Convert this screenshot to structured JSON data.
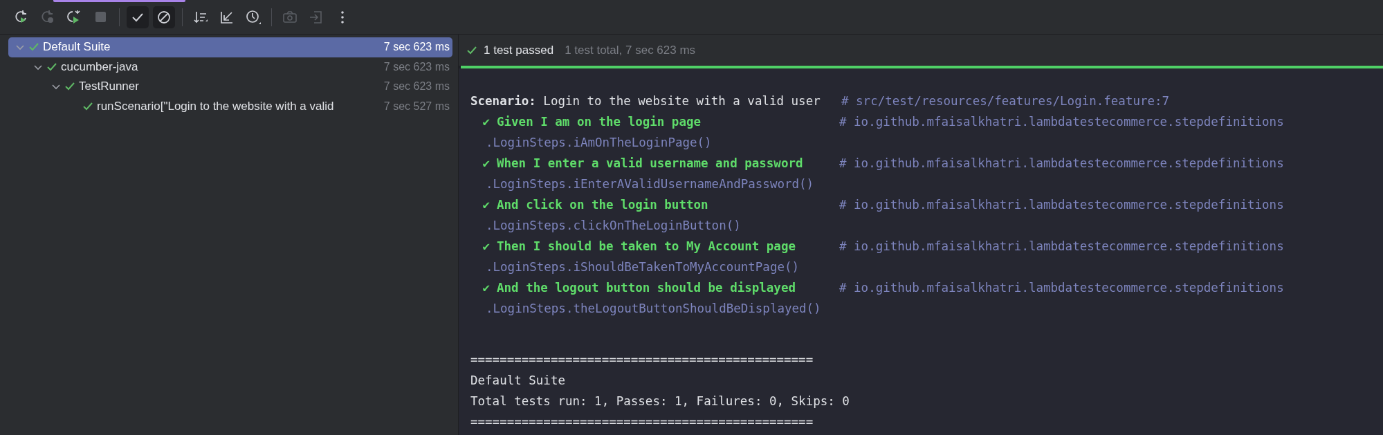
{
  "toolbar": {
    "buttons": [
      {
        "kind": "rerun",
        "disabled": false,
        "selected": false
      },
      {
        "kind": "rerun-failed",
        "disabled": true,
        "selected": false
      },
      {
        "kind": "rerun-toggle",
        "disabled": false,
        "selected": false
      },
      {
        "kind": "stop",
        "disabled": true,
        "selected": false
      },
      {
        "kind": "separator"
      },
      {
        "kind": "show-passed",
        "disabled": false,
        "selected": true
      },
      {
        "kind": "show-ignored",
        "disabled": false,
        "selected": true
      },
      {
        "kind": "separator"
      },
      {
        "kind": "sort",
        "disabled": false,
        "selected": false
      },
      {
        "kind": "import",
        "disabled": false,
        "selected": false
      },
      {
        "kind": "history",
        "disabled": false,
        "selected": false
      },
      {
        "kind": "separator"
      },
      {
        "kind": "camera",
        "disabled": true,
        "selected": false
      },
      {
        "kind": "export",
        "disabled": true,
        "selected": false
      },
      {
        "kind": "more",
        "disabled": false,
        "selected": false
      }
    ]
  },
  "tree": [
    {
      "label": "Default Suite",
      "time": "7 sec 623 ms",
      "selected": true,
      "expanded": true,
      "children": [
        {
          "label": "cucumber-java",
          "time": "7 sec 623 ms",
          "selected": false,
          "expanded": true,
          "children": [
            {
              "label": "TestRunner",
              "time": "7 sec 623 ms",
              "selected": false,
              "expanded": true,
              "children": [
                {
                  "label": "runScenario[\"Login to the website with a valid",
                  "time": "7 sec 527 ms",
                  "selected": false
                }
              ]
            }
          ]
        }
      ]
    }
  ],
  "summary": {
    "status": "1 test passed",
    "detail": "1 test total, 7 sec 623 ms",
    "level": 1
  },
  "console": [
    {
      "kind": "blank"
    },
    {
      "kind": "scenario",
      "text": "**Scenario:** Login to the website with a valid user",
      "comment": "# src/test/resources/features/Login.feature:7"
    },
    {
      "kind": "step",
      "mark": "✔",
      "text": "Given I am on the login page",
      "comment": "# io.github.mfaisalkhatri.lambdatestecommerce.stepdefinitions"
    },
    {
      "kind": "method",
      "text": ".LoginSteps.iAmOnTheLoginPage()"
    },
    {
      "kind": "step",
      "mark": "✔",
      "text": "When I enter a valid username and password",
      "comment": "# io.github.mfaisalkhatri.lambdatestecommerce.stepdefinitions"
    },
    {
      "kind": "method",
      "text": ".LoginSteps.iEnterAValidUsernameAndPassword()"
    },
    {
      "kind": "step",
      "mark": "✔",
      "text": "And click on the login button",
      "comment": "# io.github.mfaisalkhatri.lambdatestecommerce.stepdefinitions"
    },
    {
      "kind": "method",
      "text": ".LoginSteps.clickOnTheLoginButton()"
    },
    {
      "kind": "step",
      "mark": "✔",
      "text": "Then I should be taken to My Account page",
      "comment": "# io.github.mfaisalkhatri.lambdatestecommerce.stepdefinitions"
    },
    {
      "kind": "method",
      "text": ".LoginSteps.iShouldBeTakenToMyAccountPage()"
    },
    {
      "kind": "step",
      "mark": "✔",
      "text": "And the logout button should be displayed",
      "comment": "# io.github.mfaisalkhatri.lambdatestecommerce.stepdefinitions"
    },
    {
      "kind": "method",
      "text": ".LoginSteps.theLogoutButtonShouldBeDisplayed()"
    },
    {
      "kind": "blank"
    },
    {
      "kind": "blank"
    },
    {
      "kind": "text",
      "text": "==============================================="
    },
    {
      "kind": "text",
      "text": "Default Suite"
    },
    {
      "kind": "text",
      "text": "Total tests run: 1, Passes: 1, Failures: 0, Skips: 0"
    },
    {
      "kind": "text",
      "text": "==============================================="
    }
  ]
}
